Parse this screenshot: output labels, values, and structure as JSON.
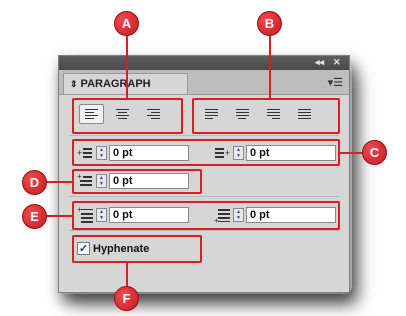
{
  "callouts": {
    "a": "A",
    "b": "B",
    "c": "C",
    "d": "D",
    "e": "E",
    "f": "F"
  },
  "panel": {
    "title_controls": {
      "collapse": "◂◂",
      "close": "✕"
    },
    "tab_label": "PARAGRAPH",
    "tab_arrow": "⇕"
  },
  "indent": {
    "left_value": "0 pt",
    "right_value": "0 pt",
    "first_line_value": "0 pt"
  },
  "spacing": {
    "before_value": "0 pt",
    "after_value": "0 pt"
  },
  "hyphenate": {
    "label": "Hyphenate",
    "checked": true,
    "mark": "✓"
  },
  "colors": {
    "callout": "#d42127",
    "panel": "#d6d6d6",
    "titlebar": "#4a4a4a"
  }
}
